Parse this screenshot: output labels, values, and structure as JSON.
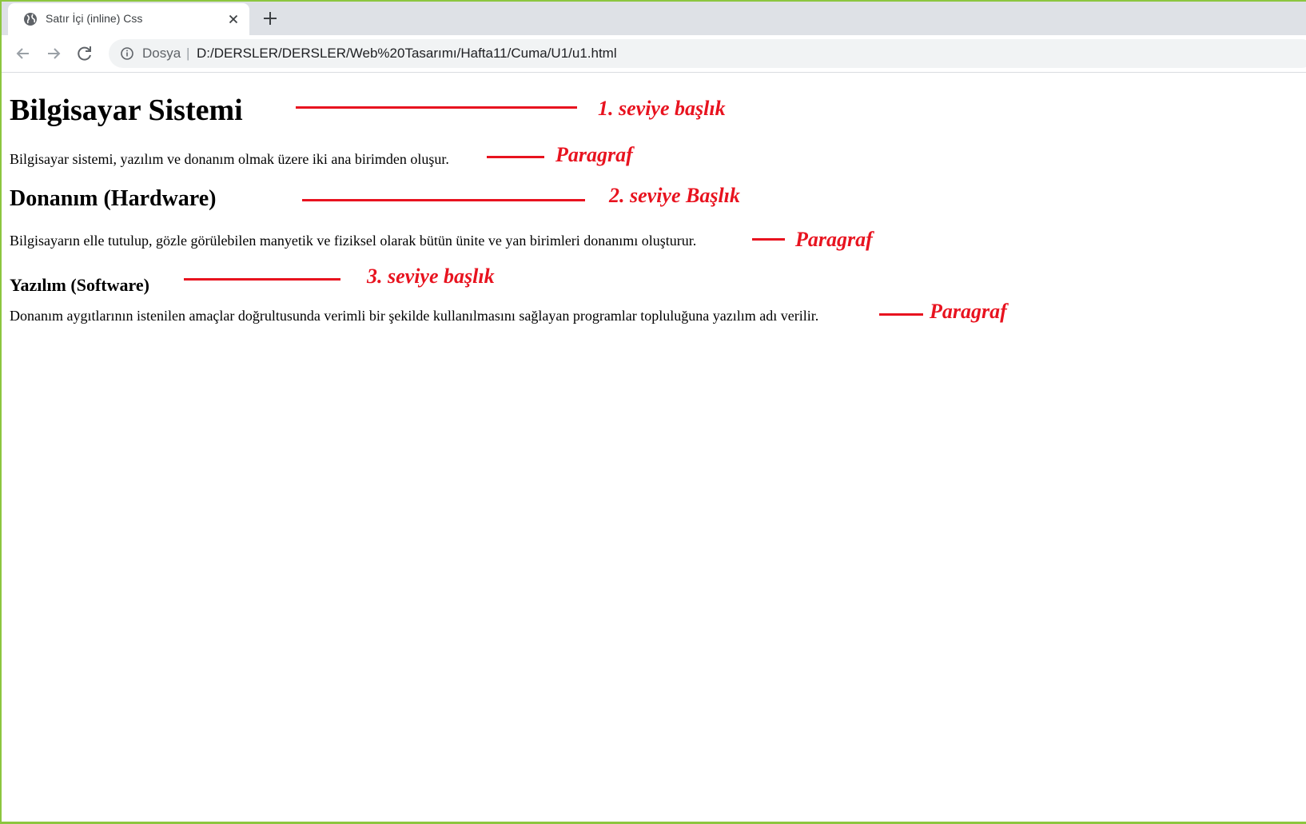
{
  "browser": {
    "tab": {
      "title": "Satır İçi (inline) Css",
      "favicon": "globe-icon",
      "close": "close-icon"
    },
    "new_tab": "plus-icon",
    "toolbar": {
      "back": "arrow-left-icon",
      "forward": "arrow-right-icon",
      "reload": "reload-icon",
      "info": "info-icon",
      "scheme_label": "Dosya",
      "separator": "|",
      "url": "D:/DERSLER/DERSLER/Web%20Tasarımı/Hafta11/Cuma/U1/u1.html"
    }
  },
  "document": {
    "h1": "Bilgisayar Sistemi",
    "p1": "Bilgisayar sistemi, yazılım ve donanım olmak üzere iki ana birimden oluşur.",
    "h2": "Donanım (Hardware)",
    "p2": "Bilgisayarın elle tutulup, gözle görülebilen manyetik ve fiziksel olarak bütün ünite ve yan birimleri donanımı oluşturur.",
    "h3": "Yazılım (Software)",
    "p3": "Donanım aygıtlarının istenilen amaçlar doğrultusunda verimli bir şekilde kullanılmasını sağlayan programlar topluluğuna yazılım adı verilir."
  },
  "annotations": {
    "color": "#e8131f",
    "h1_label": "1. seviye başlık",
    "p1_label": "Paragraf",
    "h2_label": "2. seviye Başlık",
    "p2_label": "Paragraf",
    "h3_label": "3. seviye başlık",
    "p3_label": "Paragraf"
  },
  "colors": {
    "window_border": "#8cc63f",
    "tabstrip_bg": "#dee1e6",
    "omnibox_bg": "#f1f3f4"
  }
}
